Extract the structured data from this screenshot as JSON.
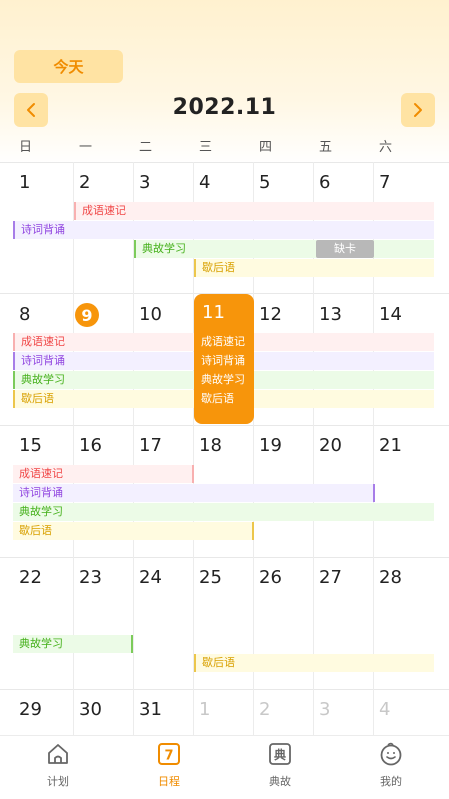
{
  "header": {
    "today_label": "今天",
    "month_title": "2022.11",
    "prev_icon": "chevron-left-icon",
    "next_icon": "chevron-right-icon"
  },
  "weekdays": [
    "日",
    "一",
    "二",
    "三",
    "四",
    "五",
    "六"
  ],
  "weeks": [
    {
      "days": [
        "1",
        "2",
        "3",
        "4",
        "5",
        "6",
        "7"
      ],
      "muted": [
        false,
        false,
        false,
        false,
        false,
        false,
        false
      ]
    },
    {
      "days": [
        "8",
        "9",
        "10",
        "11",
        "12",
        "13",
        "14"
      ],
      "muted": [
        false,
        false,
        false,
        false,
        false,
        false,
        false
      ]
    },
    {
      "days": [
        "15",
        "16",
        "17",
        "18",
        "19",
        "20",
        "21"
      ],
      "muted": [
        false,
        false,
        false,
        false,
        false,
        false,
        false
      ]
    },
    {
      "days": [
        "22",
        "23",
        "24",
        "25",
        "26",
        "27",
        "28"
      ],
      "muted": [
        false,
        false,
        false,
        false,
        false,
        false,
        false
      ]
    },
    {
      "days": [
        "29",
        "30",
        "31",
        "1",
        "2",
        "3",
        "4"
      ],
      "muted": [
        false,
        false,
        false,
        true,
        true,
        true,
        true
      ]
    }
  ],
  "today_day": "9",
  "selected_day": {
    "day": "11",
    "events": [
      "成语速记",
      "诗词背诵",
      "典故学习",
      "歇后语"
    ]
  },
  "events": {
    "idiom": "成语速记",
    "poetry": "诗词背诵",
    "allusion": "典故学习",
    "xiehouyu": "歇后语",
    "missed": "缺卡"
  },
  "colors": {
    "accent": "#f7950b",
    "red": "#f04848",
    "purple": "#9146e0",
    "green": "#44b01a",
    "yellow": "#d8a000"
  },
  "tabbar": {
    "items": [
      {
        "label": "计划",
        "icon": "house-icon"
      },
      {
        "label": "日程",
        "icon": "calendar-icon",
        "active": true,
        "glyph": "7"
      },
      {
        "label": "典故",
        "icon": "book-icon",
        "glyph": "典"
      },
      {
        "label": "我的",
        "icon": "smiley-face-icon"
      }
    ]
  }
}
